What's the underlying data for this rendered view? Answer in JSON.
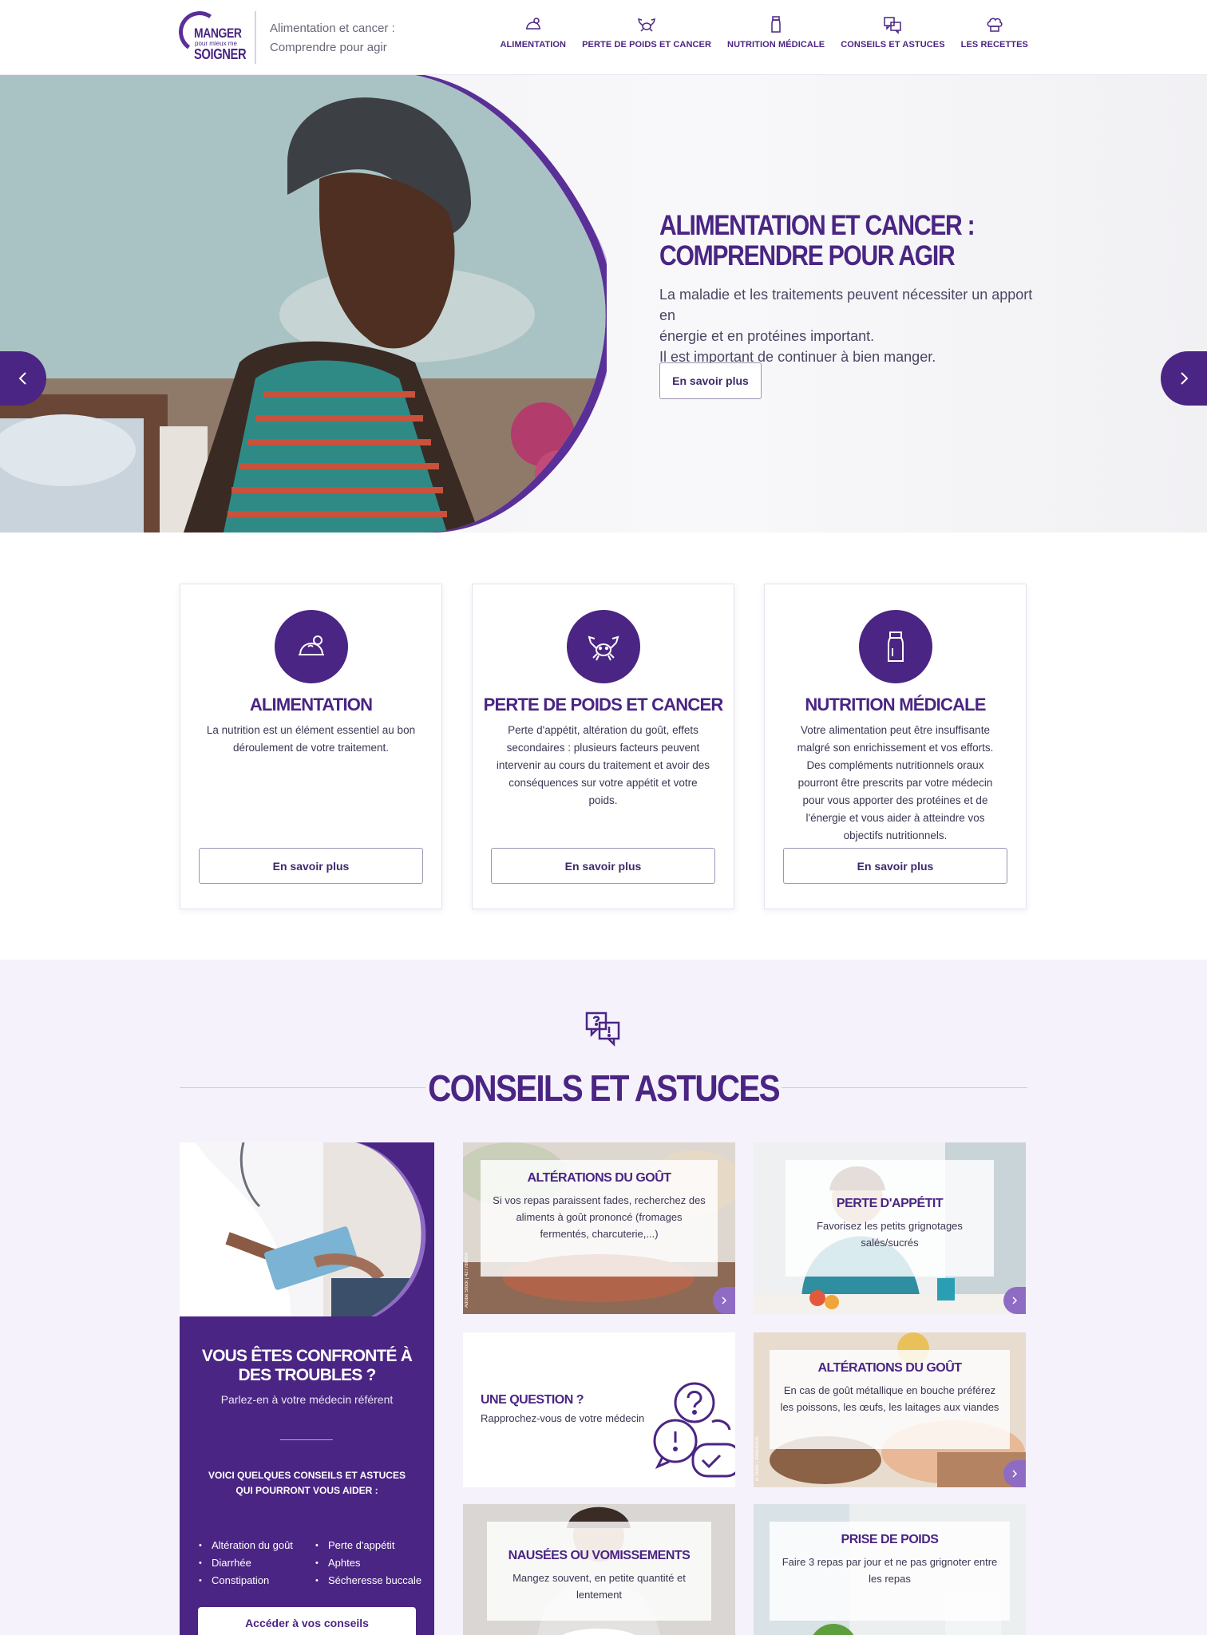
{
  "header": {
    "logo": {
      "line1": "MANGER",
      "line2": "pour mieux me",
      "line3": "SOIGNER"
    },
    "tagline_1": "Alimentation et cancer :",
    "tagline_2": "Comprendre pour agir",
    "nav": [
      {
        "label": "ALIMENTATION",
        "icon": "food-icon"
      },
      {
        "label": "PERTE DE POIDS ET CANCER",
        "icon": "crab-icon"
      },
      {
        "label": "NUTRITION MÉDICALE",
        "icon": "bottle-icon"
      },
      {
        "label": "CONSEILS ET ASTUCES",
        "icon": "chat-icon"
      },
      {
        "label": "LES RECETTES",
        "icon": "chef-hat-icon"
      }
    ]
  },
  "hero": {
    "title_1": "ALIMENTATION ET CANCER :",
    "title_2": "COMPRENDRE POUR AGIR",
    "text_1": "La maladie et les traitements peuvent nécessiter un apport en",
    "text_2": "énergie et en protéines important.",
    "text_3": "Il est important de continuer à bien manger.",
    "button": "En savoir plus",
    "slide_count": 3,
    "active_slide": 1
  },
  "cards": [
    {
      "title": "ALIMENTATION",
      "icon": "food-icon",
      "text": "La nutrition est un élément essentiel au bon déroulement de votre traitement.",
      "button": "En savoir plus"
    },
    {
      "title": "PERTE DE POIDS ET CANCER",
      "icon": "crab-icon",
      "text": "Perte d'appétit, altération du goût, effets secondaires : plusieurs facteurs peuvent intervenir au cours du traitement et avoir des conséquences sur votre appétit et votre poids.",
      "button": "En savoir plus"
    },
    {
      "title": "NUTRITION MÉDICALE",
      "icon": "bottle-icon",
      "text": "Votre alimentation peut être insuffisante malgré son enrichissement et vos efforts. Des compléments nutritionnels oraux pourront être prescrits par votre médecin pour vous apporter des protéines et de l'énergie et vous aider à atteindre vos objectifs nutritionnels.",
      "button": "En savoir plus"
    }
  ],
  "conseils": {
    "title": "CONSEILS ET ASTUCES",
    "panel": {
      "title": "VOUS ÊTES CONFRONTÉ À DES TROUBLES ?",
      "subtitle": "Parlez-en à votre médecin référent",
      "heading": "VOICI QUELQUES CONSEILS ET ASTUCES QUI POURRONT VOUS AIDER :",
      "list": [
        "Altération du goût",
        "Perte d'appétit",
        "Diarrhée",
        "Aphtes",
        "Constipation",
        "Sécheresse buccale"
      ],
      "button": "Accéder à vos conseils"
    },
    "tiles": [
      {
        "title": "ALTÉRATIONS DU GOÛT",
        "text": "Si vos repas paraissent fades, recherchez des aliments à goût prononcé (fromages fermentés, charcuterie,...)",
        "credit": "Adobe Stock | 427780854"
      },
      {
        "title": "PERTE D'APPÉTIT",
        "text": "Favorisez les petits grignotages salés/sucrés"
      },
      {
        "title": "UNE QUESTION ?",
        "text": "Rapprochez-vous de votre médecin"
      },
      {
        "title": "ALTÉRATIONS DU GOÛT",
        "text": "En cas de goût métallique en bouche préférez les poissons, les œufs, les laitages aux viandes",
        "credit": "ie Stock | 496635936"
      },
      {
        "title": "NAUSÉES OU VOMISSEMENTS",
        "text": "Mangez souvent, en petite quantité et lentement"
      },
      {
        "title": "PRISE DE POIDS",
        "text": "Faire 3 repas par jour et ne pas grignoter entre les repas"
      }
    ]
  },
  "colors": {
    "brand": "#4a2583",
    "accent": "#8e6cc4",
    "section_bg": "#f5f2fb"
  }
}
